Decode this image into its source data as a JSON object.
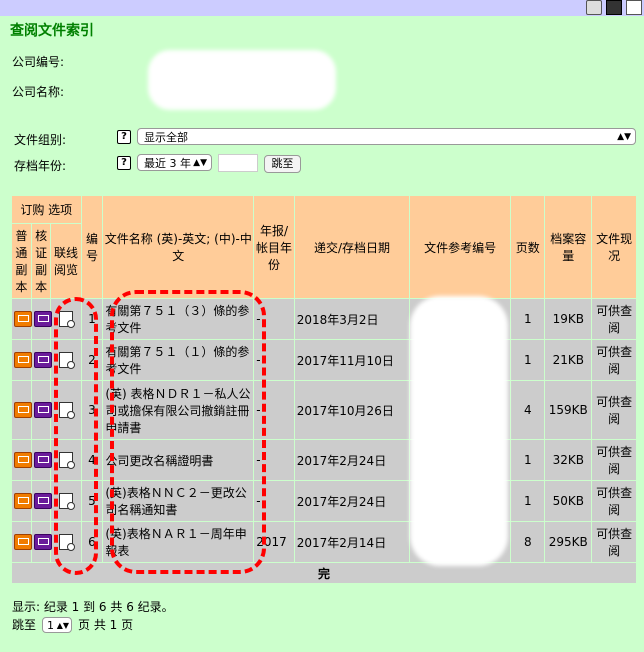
{
  "title": "查阅文件索引",
  "company_no_label": "公司编号:",
  "company_name_label": "公司名称:",
  "doc_group_label": "文件组别:",
  "doc_group_select": "显示全部",
  "year_label": "存档年份:",
  "year_select": "最近 3 年",
  "year_input": "",
  "jump_button": "跳至",
  "help_glyph": "?",
  "headers": {
    "order_options": "订购 选项",
    "normal_copy": "普通副本",
    "certified_copy": "核证副本",
    "online_view": "联线阅览",
    "no": "编号",
    "doc_name": "文件名称 (英)-英文; (中)-中文",
    "annual_year": "年报/帐目年份",
    "filing_date": "递交/存档日期",
    "ref_no": "文件参考编号",
    "pages": "页数",
    "size": "档案容量",
    "status": "文件现况"
  },
  "rows": [
    {
      "no": "1",
      "name": "有關第７５１（３）條的参考文件",
      "year": "-",
      "date": "2018年3月2日",
      "pages": "1",
      "size": "19KB",
      "status": "可供查阅"
    },
    {
      "no": "2",
      "name": "有關第７５１（１）條的参考文件",
      "year": "-",
      "date": "2017年11月10日",
      "pages": "1",
      "size": "21KB",
      "status": "可供查阅"
    },
    {
      "no": "3",
      "name": "(英) 表格ＮＤＲ１－私人公司或擔保有限公司撤銷註冊申請書",
      "year": "-",
      "date": "2017年10月26日",
      "pages": "4",
      "size": "159KB",
      "status": "可供查阅"
    },
    {
      "no": "4",
      "name": "公司更改名稱證明書",
      "year": "-",
      "date": "2017年2月24日",
      "pages": "1",
      "size": "32KB",
      "status": "可供查阅"
    },
    {
      "no": "5",
      "name": "(英)表格ＮＮＣ２－更改公司名稱通知書",
      "year": "-",
      "date": "2017年2月24日",
      "pages": "1",
      "size": "50KB",
      "status": "可供查阅"
    },
    {
      "no": "6",
      "name": "(英)表格ＮＡＲ１－周年申報表",
      "year": "2017",
      "date": "2017年2月14日",
      "pages": "8",
      "size": "295KB",
      "status": "可供查阅"
    }
  ],
  "footer_label": "完",
  "record_summary": "显示: 纪录 1 到 6 共 6 纪录。",
  "page_jump_label": "跳至",
  "page_select": "1",
  "page_total": "页  共 1 页"
}
